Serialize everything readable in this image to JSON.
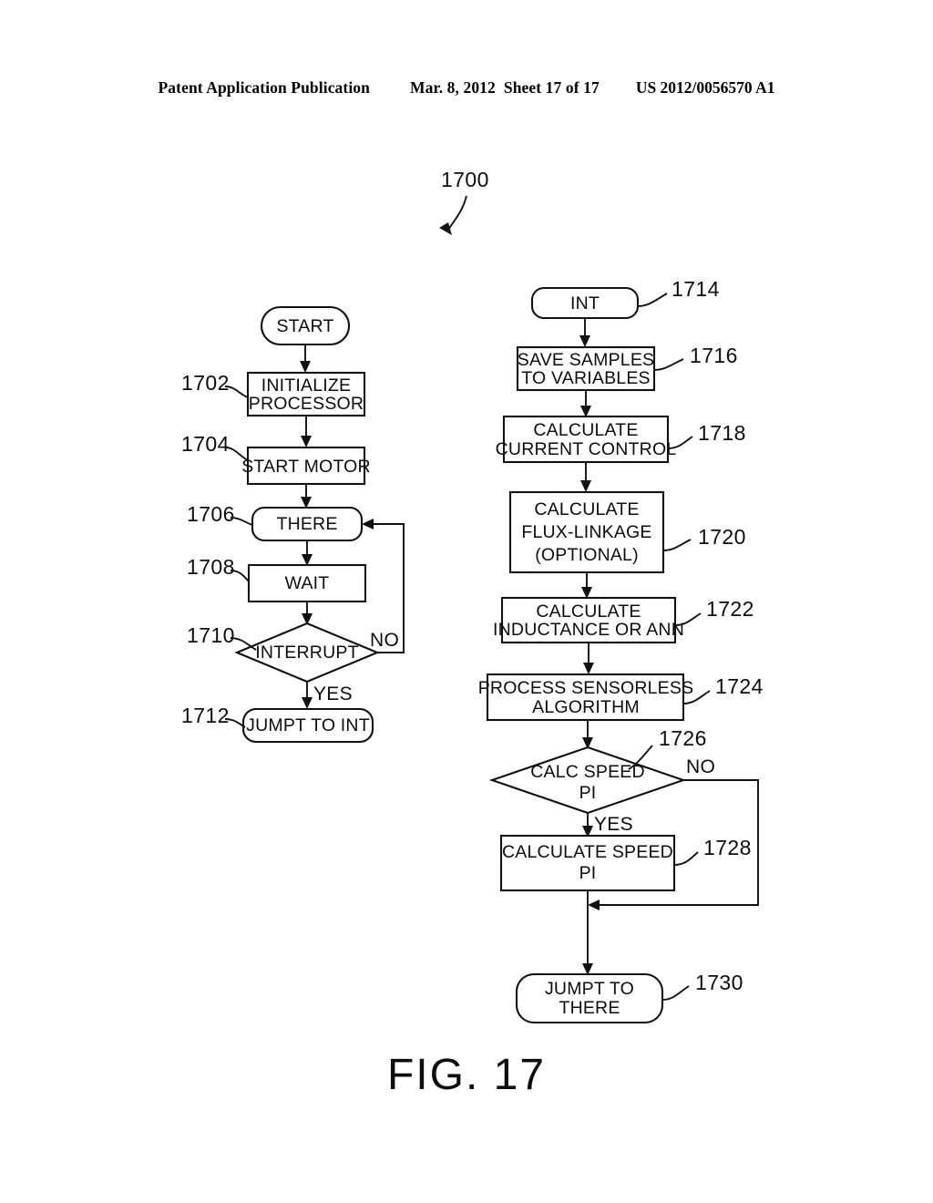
{
  "header": {
    "publication": "Patent Application Publication",
    "date": "Mar. 8, 2012",
    "sheet": "Sheet 17 of 17",
    "doc_number": "US 2012/0056570 A1"
  },
  "figure": {
    "caption": "FIG. 17",
    "diagram_ref": "1700"
  },
  "left_column": {
    "start": {
      "ref": "",
      "label": "START"
    },
    "initialize": {
      "ref": "1702",
      "line1": "INITIALIZE",
      "line2": "PROCESSOR"
    },
    "start_motor": {
      "ref": "1704",
      "label": "START MOTOR"
    },
    "there": {
      "ref": "1706",
      "label": "THERE"
    },
    "wait": {
      "ref": "1708",
      "label": "WAIT"
    },
    "interrupt": {
      "ref": "1710",
      "label": "INTERRUPT",
      "yes": "YES",
      "no": "NO"
    },
    "jump_to_int": {
      "ref": "1712",
      "label": "JUMPT TO INT"
    }
  },
  "right_column": {
    "int": {
      "ref": "1714",
      "label": "INT"
    },
    "save_samples": {
      "ref": "1716",
      "line1": "SAVE SAMPLES",
      "line2": "TO VARIABLES"
    },
    "current_control": {
      "ref": "1718",
      "line1": "CALCULATE",
      "line2": "CURRENT CONTROL"
    },
    "flux_linkage": {
      "ref": "1720",
      "line1": "CALCULATE",
      "line2": "FLUX-LINKAGE",
      "line3": "(OPTIONAL)"
    },
    "inductance": {
      "ref": "1722",
      "line1": "CALCULATE",
      "line2": "INDUCTANCE OR ANN"
    },
    "sensorless": {
      "ref": "1724",
      "line1": "PROCESS SENSORLESS",
      "line2": "ALGORITHM"
    },
    "calc_speed_pi": {
      "ref": "1726",
      "line1": "CALC SPEED",
      "line2": "PI",
      "yes": "YES",
      "no": "NO"
    },
    "calculate_speed_pi": {
      "ref": "1728",
      "line1": "CALCULATE SPEED",
      "line2": "PI"
    },
    "jump_to_there": {
      "ref": "1730",
      "line1": "JUMPT TO",
      "line2": "THERE"
    }
  },
  "colors": {
    "ink": "#111111",
    "paper": "#ffffff"
  }
}
